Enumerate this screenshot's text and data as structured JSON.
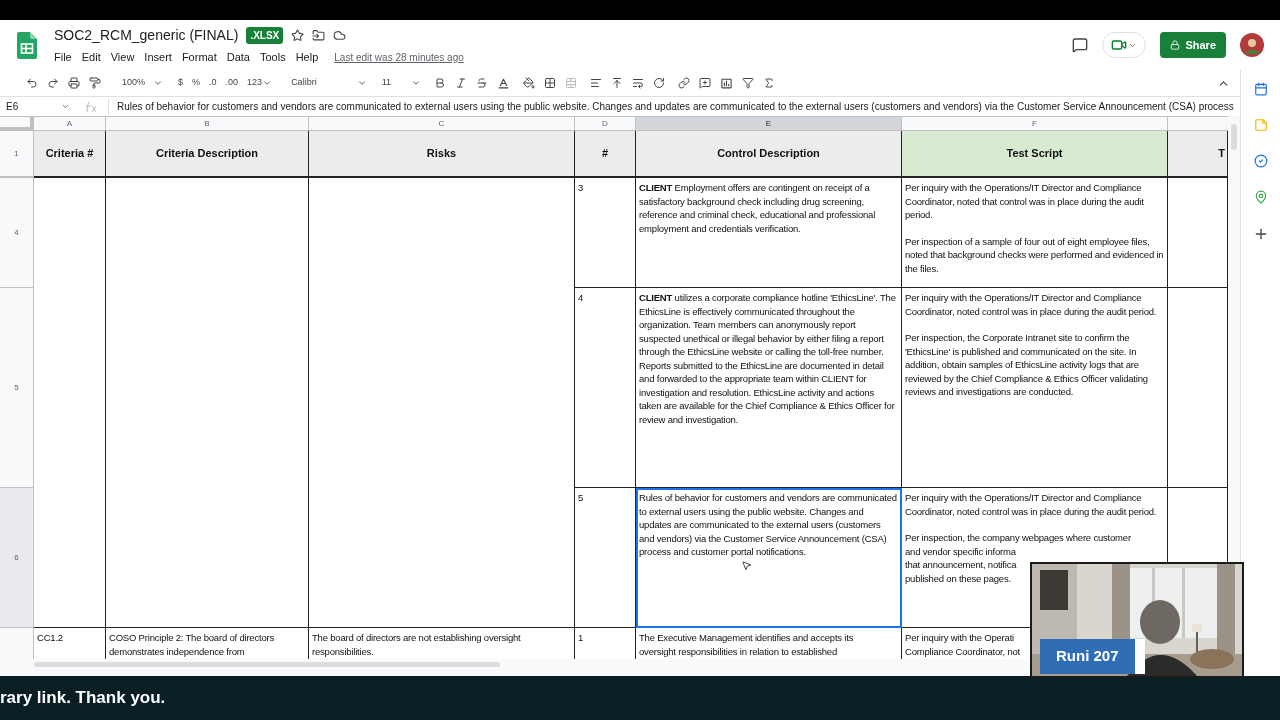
{
  "document": {
    "title": "SOC2_RCM_generic (FINAL)",
    "badge": ".XLSX",
    "menu": [
      "File",
      "Edit",
      "View",
      "Insert",
      "Format",
      "Data",
      "Tools",
      "Help"
    ],
    "last_edit": "Last edit was 28 minutes ago"
  },
  "share": {
    "label": "Share"
  },
  "toolbar": {
    "zoom": "100%",
    "currency": "$",
    "percent": "%",
    "decrease_decimals": ".0",
    "increase_decimals": ".00",
    "number_format": "123",
    "font": "Calibri",
    "font_size": "11"
  },
  "formula_bar": {
    "cell": "E6",
    "formula": "Rules of behavior for customers and vendors are communicated to external users using the public website. Changes and updates are communicated to the external users (customers and vendors) via the Customer Service Announcement (CSA) process"
  },
  "columns": [
    {
      "letter": "A",
      "selected": false
    },
    {
      "letter": "B",
      "selected": false
    },
    {
      "letter": "C",
      "selected": false
    },
    {
      "letter": "D",
      "selected": false
    },
    {
      "letter": "E",
      "selected": true
    },
    {
      "letter": "F",
      "selected": false
    }
  ],
  "header_row": {
    "number": "1",
    "cells": [
      {
        "text": "Criteria #",
        "color": "#ececec"
      },
      {
        "text": "Criteria Description",
        "color": "#ececec"
      },
      {
        "text": "Risks",
        "color": "#ececec"
      },
      {
        "text": "#",
        "color": "#ececec"
      },
      {
        "text": "Control Description",
        "color": "#ececec"
      },
      {
        "text": "Test Script",
        "color": "#d9ead3"
      },
      {
        "text": "T",
        "color": "#ececec"
      }
    ]
  },
  "rows": [
    {
      "number": "4",
      "selected": false,
      "kind": "continuation",
      "cells": [
        {
          "selected": false,
          "blocks": [
            {
              "kind": "paragraph",
              "text": "3"
            }
          ]
        },
        {
          "selected": false,
          "blocks": [
            {
              "kind": "paragraph",
              "text": "**CLIENT** Employment offers are contingent on receipt of a satisfactory background check including drug screening, reference and criminal check, educational and professional employment and credentials verification."
            }
          ]
        },
        {
          "selected": false,
          "blocks": [
            {
              "kind": "paragraph",
              "text": "Per inquiry with the Operations/IT Director and Compliance Coordinator, noted that control was in place during the audit period."
            },
            {
              "kind": "paragraph",
              "text": "Per inspection of a sample of four out of eight employee files, noted that background checks were performed and evidenced in the files."
            }
          ]
        }
      ]
    },
    {
      "number": "5",
      "selected": false,
      "kind": "continuation",
      "cells": [
        {
          "selected": false,
          "blocks": [
            {
              "kind": "paragraph",
              "text": "4"
            }
          ]
        },
        {
          "selected": false,
          "blocks": [
            {
              "kind": "paragraph",
              "text": "**CLIENT** utilizes a corporate compliance hotline 'EthicsLine'. The EthicsLine is effectively communicated throughout the organization. Team members can anonymously report suspected unethical or illegal behavior by either filing a report through the EthicsLine website or calling the toll-free number. Reports submitted to the EthicsLine are documented in detail and forwarded to the appropriate team within CLIENT for investigation and resolution. EthicsLine activity and actions taken are available for the Chief Compliance & Ethics Officer for review and investigation."
            }
          ]
        },
        {
          "selected": false,
          "blocks": [
            {
              "kind": "paragraph",
              "text": "Per inquiry with the Operations/IT Director and Compliance Coordinator, noted control was in place during the audit period."
            },
            {
              "kind": "paragraph",
              "text": "Per inspection, the Corporate Intranet site to confirm the 'EthicsLine' is published and communicated on the site. In addition, obtain samples of EthicsLine activity logs that are reviewed by the Chief Compliance & Ethics Officer validating reviews and investigations are conducted."
            }
          ]
        }
      ]
    },
    {
      "number": "6",
      "selected": true,
      "kind": "continuation",
      "cells": [
        {
          "selected": false,
          "blocks": [
            {
              "kind": "paragraph",
              "text": "5"
            }
          ]
        },
        {
          "selected": true,
          "blocks": [
            {
              "kind": "paragraph",
              "text": "Rules of behavior for customers and vendors are communicated to external users using the public website. Changes and updates are communicated to the external users (customers and vendors) via the Customer Service Announcement (CSA) process and customer portal notifications."
            }
          ]
        },
        {
          "selected": false,
          "blocks": [
            {
              "kind": "paragraph",
              "text": "Per inquiry with the Operations/IT Director and Compliance Coordinator, noted control was in place during the audit period."
            },
            {
              "kind": "line",
              "text": "Per inspection, the company webpages where customer"
            },
            {
              "kind": "line",
              "text": "and vendor specific informa"
            },
            {
              "kind": "line",
              "text": "that announcement, notifica"
            },
            {
              "kind": "line",
              "text": "published on these pages."
            }
          ]
        }
      ]
    },
    {
      "selected": false,
      "kind": "full",
      "cells": [
        {
          "selected": false,
          "blocks": [
            {
              "kind": "line",
              "text": "CC1.2"
            }
          ]
        },
        {
          "selected": false,
          "blocks": [
            {
              "kind": "line",
              "text": "COSO Principle 2: The board of directors"
            },
            {
              "kind": "line",
              "text": "demonstrates independence from"
            }
          ]
        },
        {
          "selected": false,
          "blocks": [
            {
              "kind": "line",
              "text": "The board of directors are not establishing oversight"
            },
            {
              "kind": "line",
              "text": "responsibilities."
            }
          ]
        },
        {
          "selected": false,
          "blocks": [
            {
              "kind": "line",
              "text": "1"
            }
          ]
        },
        {
          "selected": false,
          "blocks": [
            {
              "kind": "line",
              "text": "The Executive Management identifies and accepts its"
            },
            {
              "kind": "line",
              "text": "oversight responsibilities in relation to established"
            }
          ]
        },
        {
          "selected": false,
          "blocks": [
            {
              "kind": "line",
              "text": "Per inquiry with the Operati"
            },
            {
              "kind": "line",
              "text": "Compliance Coordinator, not"
            }
          ]
        }
      ]
    }
  ],
  "video": {
    "name": "Runi 207"
  },
  "caption": "rary link. Thank you."
}
